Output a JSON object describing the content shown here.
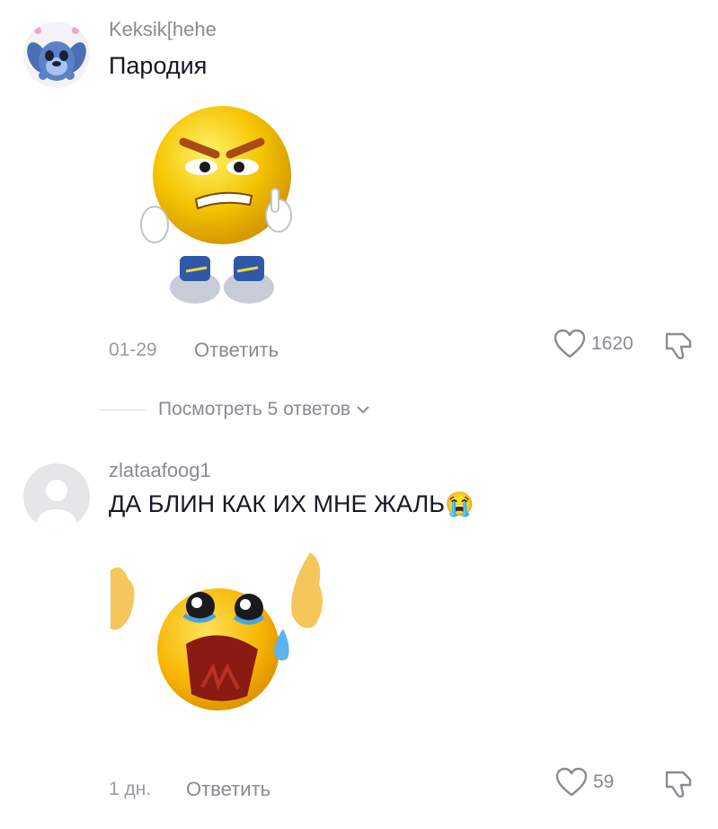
{
  "comments": [
    {
      "username": "Keksik[hehe",
      "text": "Пародия",
      "date": "01-29",
      "reply_label": "Ответить",
      "likes": "1620",
      "avatar_icon": "stitch-avatar-icon",
      "sticker": "angry-emoji-sticker"
    },
    {
      "username": "zlataafoog1",
      "text": "ДА БЛИН КАК ИХ МНЕ ЖАЛЬ",
      "text_emoji": "😭",
      "date": "1 дн.",
      "reply_label": "Ответить",
      "likes": "59",
      "avatar_icon": "default-user-avatar-icon",
      "sticker": "crying-emoji-sticker"
    }
  ],
  "view_replies": {
    "label": "Посмотреть 5 ответов"
  },
  "colors": {
    "text": "#161823",
    "meta": "#8a8b91",
    "emoji_yellow": "#f5c400"
  }
}
